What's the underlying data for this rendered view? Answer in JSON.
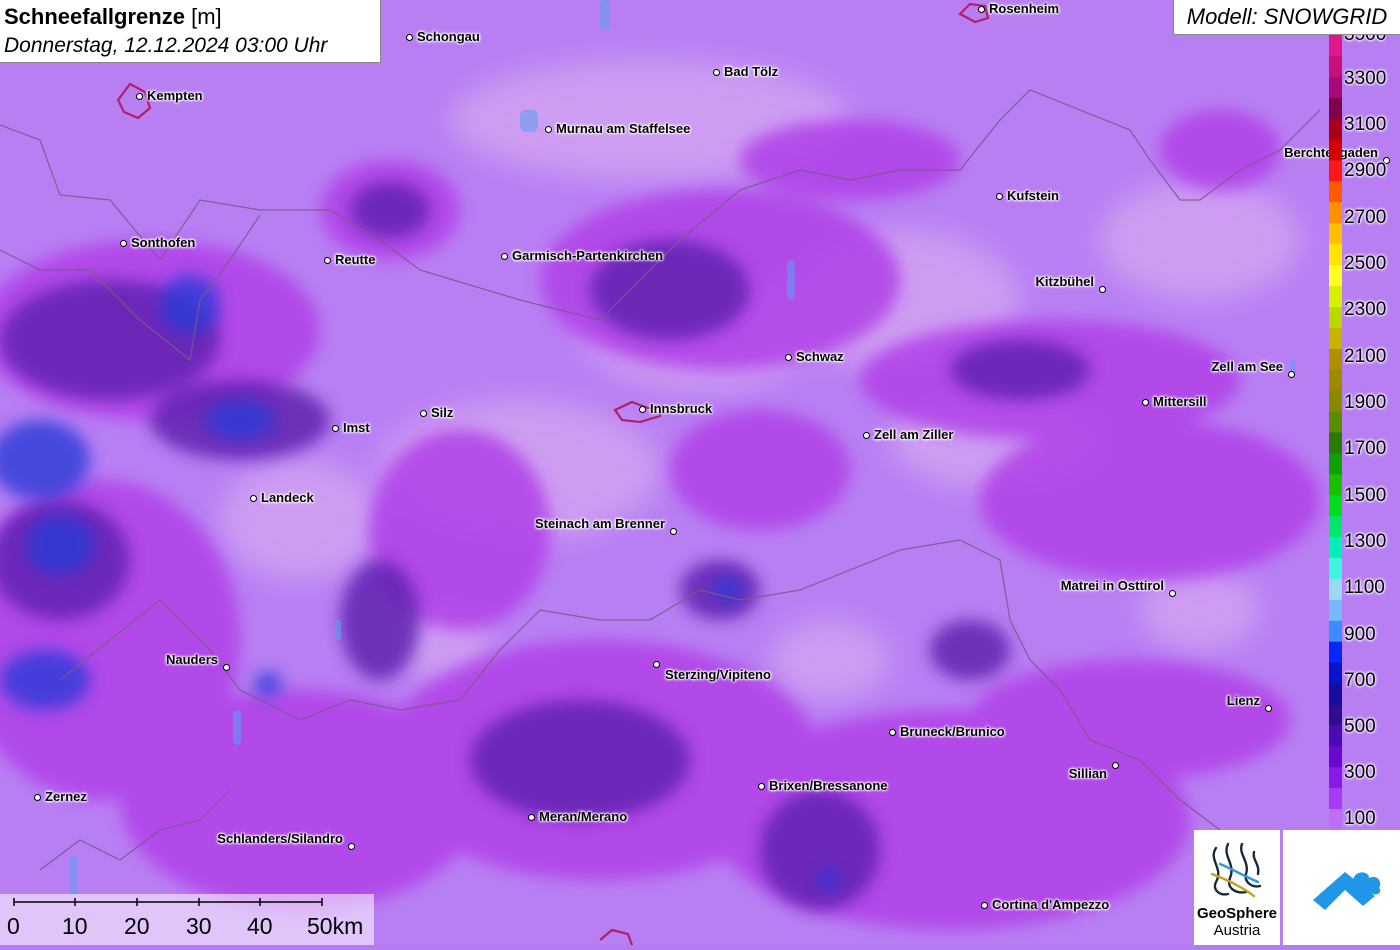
{
  "header": {
    "title_bold": "Schneefallgrenze",
    "title_unit": "[m]",
    "datetime": "Donnerstag, 12.12.2024 03:00 Uhr"
  },
  "model": {
    "label": "Modell: SNOWGRID"
  },
  "legend": {
    "labels": [
      "3500",
      "3300",
      "3100",
      "2900",
      "2700",
      "2500",
      "2300",
      "2100",
      "1900",
      "1700",
      "1500",
      "1300",
      "1100",
      "900",
      "700",
      "500",
      "300",
      "100"
    ],
    "colors": [
      "#e0168a",
      "#c8107a",
      "#a8087a",
      "#80004a",
      "#a80018",
      "#d40000",
      "#ff1818",
      "#ff5a00",
      "#ff9000",
      "#ffbe00",
      "#ffe400",
      "#ffff20",
      "#d8f000",
      "#b8d800",
      "#c8b400",
      "#b09000",
      "#a08800",
      "#8a8a00",
      "#5a8c00",
      "#287a00",
      "#10a000",
      "#18c000",
      "#00dc20",
      "#00e868",
      "#00f0b8",
      "#40f4e0",
      "#9cd8f4",
      "#78b8f8",
      "#3a8cff",
      "#0828f8",
      "#0814c8",
      "#180c9c",
      "#300c90",
      "#4a0cb0",
      "#6a08d0",
      "#8c18e8",
      "#a83cf4",
      "#bd6ef8"
    ]
  },
  "cities": [
    {
      "name": "Rosenheim"
    },
    {
      "name": "Schongau"
    },
    {
      "name": "Bad Tölz"
    },
    {
      "name": "Kempten"
    },
    {
      "name": "Murnau am Staffelsee"
    },
    {
      "name": "Berchtesgaden"
    },
    {
      "name": "Kufstein"
    },
    {
      "name": "Sonthofen"
    },
    {
      "name": "Reutte"
    },
    {
      "name": "Garmisch-Partenkirchen"
    },
    {
      "name": "Kitzbühel"
    },
    {
      "name": "Schwaz"
    },
    {
      "name": "Zell am See"
    },
    {
      "name": "Mittersill"
    },
    {
      "name": "Innsbruck"
    },
    {
      "name": "Silz"
    },
    {
      "name": "Imst"
    },
    {
      "name": "Zell am Ziller"
    },
    {
      "name": "Landeck"
    },
    {
      "name": "Steinach am Brenner"
    },
    {
      "name": "Matrei in Osttirol"
    },
    {
      "name": "Nauders"
    },
    {
      "name": "Sterzing/Vipiteno"
    },
    {
      "name": "Lienz"
    },
    {
      "name": "Bruneck/Brunico"
    },
    {
      "name": "Sillian"
    },
    {
      "name": "Brixen/Bressanone"
    },
    {
      "name": "Zernez"
    },
    {
      "name": "Meran/Merano"
    },
    {
      "name": "Schlanders/Silandro"
    },
    {
      "name": "Cortina d'Ampezzo"
    }
  ],
  "scale": {
    "labels": [
      "0",
      "10",
      "20",
      "30",
      "40",
      "50km"
    ]
  },
  "logo": {
    "name": "GeoSphere",
    "sub": "Austria"
  }
}
